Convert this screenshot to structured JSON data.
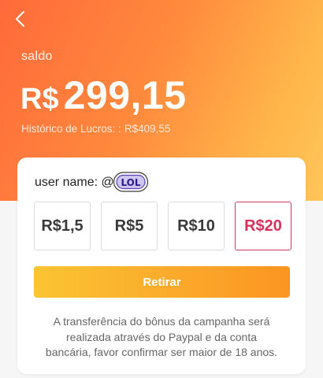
{
  "header": {
    "balance_label": "saldo",
    "currency": "R$",
    "amount": "299,15",
    "history_label": "Histórico de Lucros: :",
    "history_value": "R$409,55"
  },
  "card": {
    "user_label": "user name: @",
    "sticker_text": "LOL",
    "amounts": [
      {
        "label": "R$1,5",
        "selected": false
      },
      {
        "label": "R$5",
        "selected": false
      },
      {
        "label": "R$10",
        "selected": false
      },
      {
        "label": "R$20",
        "selected": true
      }
    ],
    "withdraw_label": "Retirar",
    "note_line1": "A transferência do bônus da campanha será",
    "note_line2": "realizada através do Paypal e da conta",
    "note_line3": "bancária, favor confirmar ser maior de 18 anos."
  },
  "colors": {
    "gradient_start": "#ff6a3a",
    "gradient_end": "#ffc65a",
    "selected_accent": "#d8315c",
    "button_start": "#fbc433",
    "button_end": "#fb9522"
  },
  "icons": {
    "back": "chevron-left-icon",
    "sticker": "lol-sticker-icon"
  }
}
